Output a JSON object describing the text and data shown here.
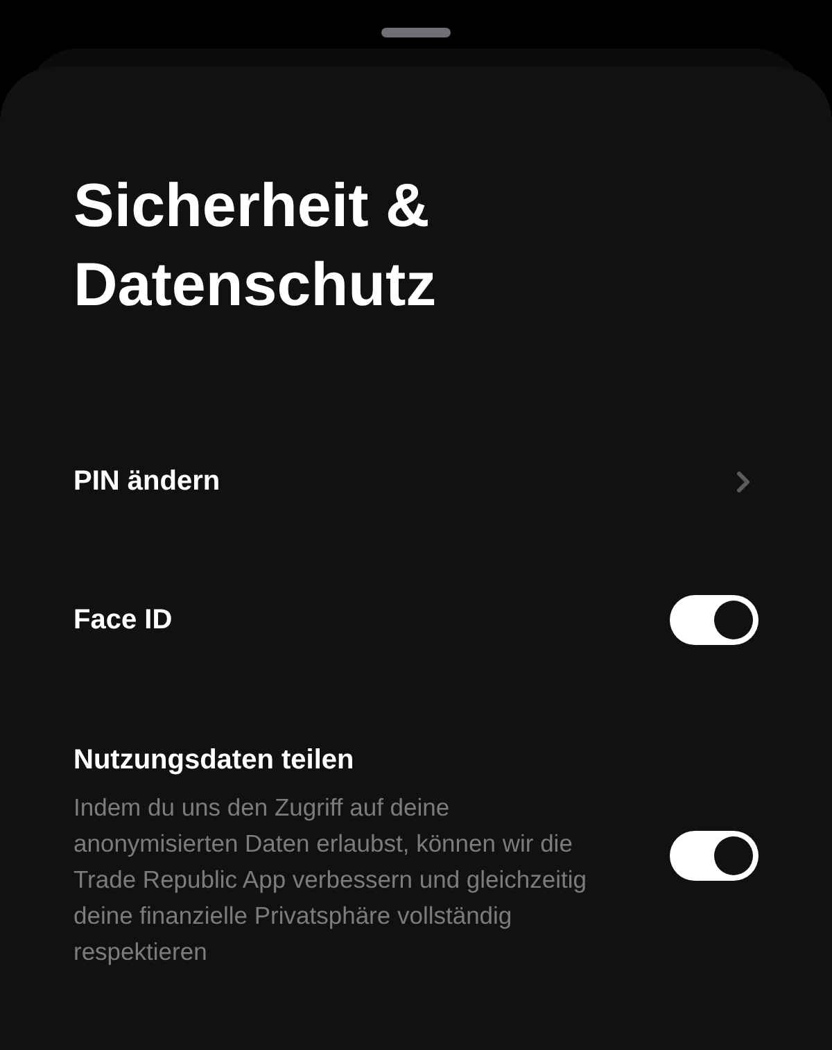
{
  "title": "Sicherheit & Datenschutz",
  "settings": [
    {
      "kind": "link",
      "label": "PIN ändern"
    },
    {
      "kind": "toggle",
      "label": "Face ID",
      "on": true
    },
    {
      "kind": "toggle",
      "label": "Nutzungsdaten teilen",
      "description": "Indem du uns den Zugriff auf deine anonymisierten Daten erlaubst, können wir die Trade Republic App verbessern und gleichzeitig deine finanzielle Privatsphäre vollständig respektieren",
      "on": true
    }
  ]
}
